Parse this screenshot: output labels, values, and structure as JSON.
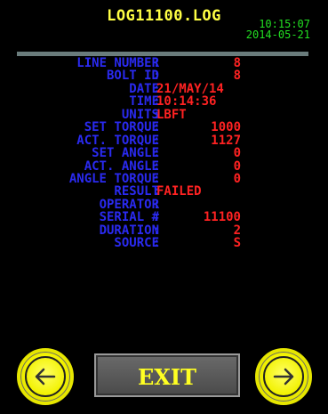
{
  "header": {
    "title": "LOG11100.LOG",
    "time": "10:15:07",
    "date": "2014-05-21"
  },
  "record": [
    {
      "label": "LINE NUMBER",
      "value": "8"
    },
    {
      "label": "BOLT ID",
      "value": "8"
    },
    {
      "label": "DATE",
      "value": "21/MAY/14"
    },
    {
      "label": "TIME",
      "value": "10:14:36"
    },
    {
      "label": "UNITS",
      "value": "LBFT"
    },
    {
      "label": "SET TORQUE",
      "value": "1000"
    },
    {
      "label": "ACT. TORQUE",
      "value": "1127"
    },
    {
      "label": "SET ANGLE",
      "value": "0"
    },
    {
      "label": "ACT. ANGLE",
      "value": "0"
    },
    {
      "label": "ANGLE TORQUE",
      "value": "0"
    },
    {
      "label": "RESULT",
      "value": "FAILED"
    },
    {
      "label": "OPERATOR",
      "value": ""
    },
    {
      "label": "SERIAL #",
      "value": "11100"
    },
    {
      "label": "DURATION",
      "value": "2"
    },
    {
      "label": "SOURCE",
      "value": "S"
    }
  ],
  "footer": {
    "exit_label": "EXIT",
    "prev_icon": "arrow-left-icon",
    "next_icon": "arrow-right-icon"
  },
  "colors": {
    "label": "#2a2af0",
    "value": "#ff2222",
    "title": "#ffff44",
    "clock": "#22e022",
    "button": "#f2f200"
  }
}
